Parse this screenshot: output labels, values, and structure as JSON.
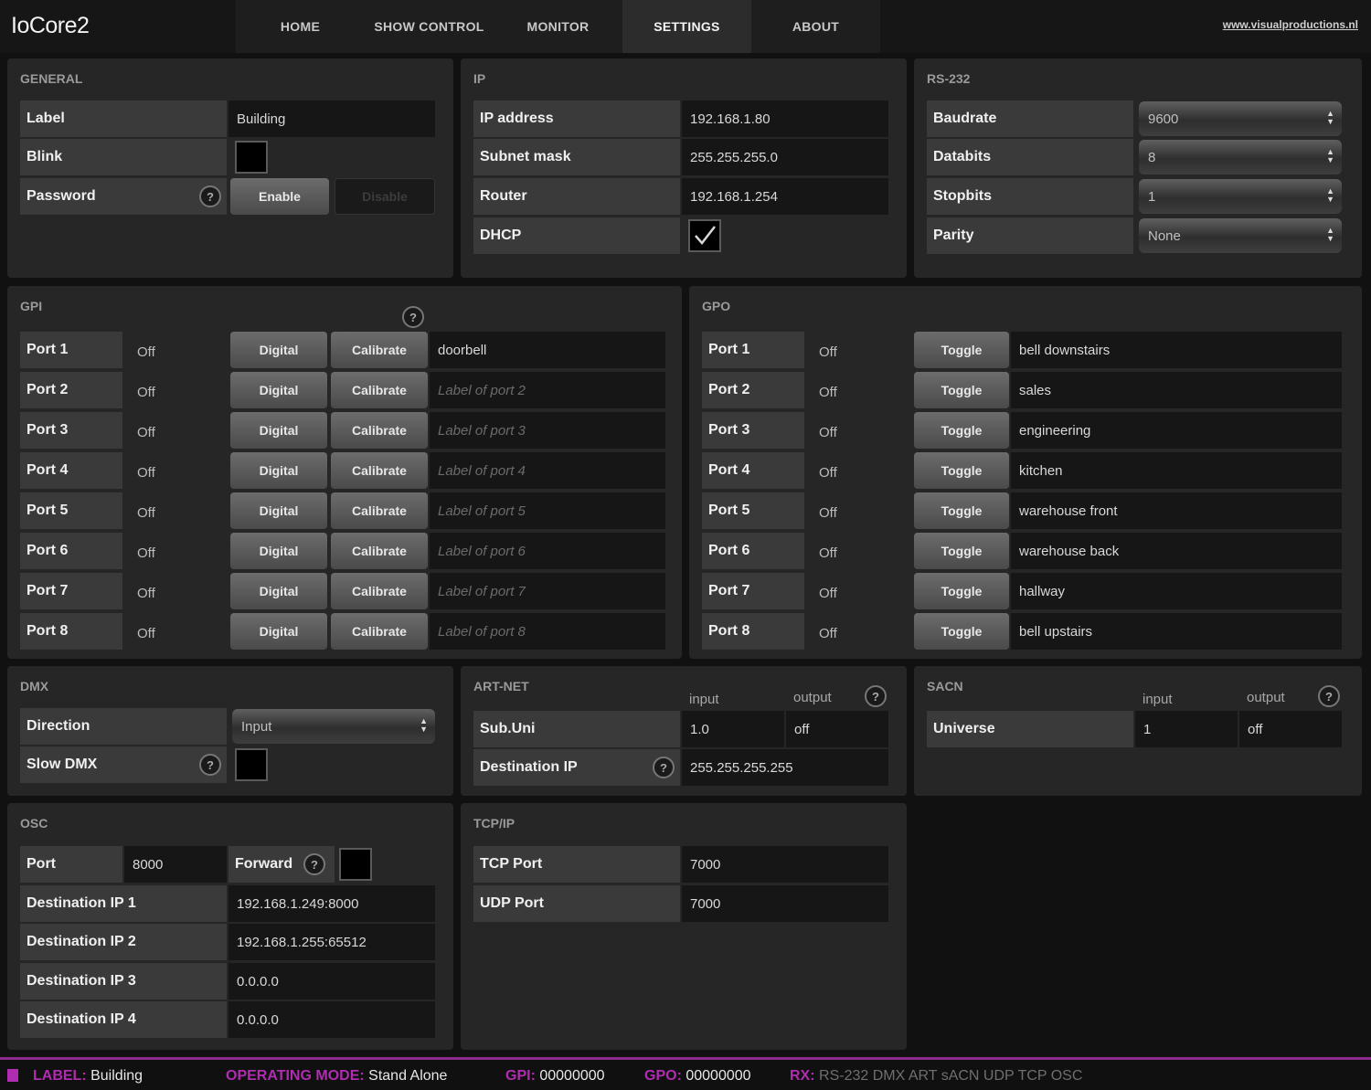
{
  "app": {
    "title": "IoCore2",
    "website": "www.visualproductions.nl",
    "accent_color": "#b02cb0",
    "nav": [
      "HOME",
      "SHOW CONTROL",
      "MONITOR",
      "SETTINGS",
      "ABOUT"
    ],
    "active_nav": "SETTINGS"
  },
  "general": {
    "title": "GENERAL",
    "label_label": "Label",
    "label_value": "Building",
    "blink_label": "Blink",
    "blink_checked": false,
    "password_label": "Password",
    "password_help_icon": "help-icon",
    "enable_label": "Enable",
    "disable_label": "Disable"
  },
  "ip": {
    "title": "IP",
    "address_label": "IP address",
    "address_value": "192.168.1.80",
    "subnet_label": "Subnet mask",
    "subnet_value": "255.255.255.0",
    "router_label": "Router",
    "router_value": "192.168.1.254",
    "dhcp_label": "DHCP",
    "dhcp_checked": true
  },
  "rs232": {
    "title": "RS-232",
    "baud_label": "Baudrate",
    "baud_value": "9600",
    "databits_label": "Databits",
    "databits_value": "8",
    "stopbits_label": "Stopbits",
    "stopbits_value": "1",
    "parity_label": "Parity",
    "parity_value": "None"
  },
  "gpi": {
    "title": "GPI",
    "digital_label": "Digital",
    "calibrate_label": "Calibrate",
    "ports": [
      {
        "name": "Port 1",
        "state": "Off",
        "label": "doorbell",
        "is_placeholder": false
      },
      {
        "name": "Port 2",
        "state": "Off",
        "label": "Label of port 2",
        "is_placeholder": true
      },
      {
        "name": "Port 3",
        "state": "Off",
        "label": "Label of port 3",
        "is_placeholder": true
      },
      {
        "name": "Port 4",
        "state": "Off",
        "label": "Label of port 4",
        "is_placeholder": true
      },
      {
        "name": "Port 5",
        "state": "Off",
        "label": "Label of port 5",
        "is_placeholder": true
      },
      {
        "name": "Port 6",
        "state": "Off",
        "label": "Label of port 6",
        "is_placeholder": true
      },
      {
        "name": "Port 7",
        "state": "Off",
        "label": "Label of port 7",
        "is_placeholder": true
      },
      {
        "name": "Port 8",
        "state": "Off",
        "label": "Label of port 8",
        "is_placeholder": true
      }
    ]
  },
  "gpo": {
    "title": "GPO",
    "toggle_label": "Toggle",
    "ports": [
      {
        "name": "Port 1",
        "state": "Off",
        "label": "bell downstairs"
      },
      {
        "name": "Port 2",
        "state": "Off",
        "label": "sales"
      },
      {
        "name": "Port 3",
        "state": "Off",
        "label": "engineering"
      },
      {
        "name": "Port 4",
        "state": "Off",
        "label": "kitchen"
      },
      {
        "name": "Port 5",
        "state": "Off",
        "label": "warehouse front"
      },
      {
        "name": "Port 6",
        "state": "Off",
        "label": "warehouse back"
      },
      {
        "name": "Port 7",
        "state": "Off",
        "label": "hallway"
      },
      {
        "name": "Port 8",
        "state": "Off",
        "label": "bell upstairs"
      }
    ]
  },
  "dmx": {
    "title": "DMX",
    "direction_label": "Direction",
    "direction_value": "Input",
    "slow_label": "Slow DMX",
    "slow_checked": false
  },
  "artnet": {
    "title": "ART-NET",
    "input_head": "input",
    "output_head": "output",
    "subuni_label": "Sub.Uni",
    "subuni_input": "1.0",
    "subuni_output": "off",
    "dest_label": "Destination IP",
    "dest_value": "255.255.255.255"
  },
  "sacn": {
    "title": "SACN",
    "input_head": "input",
    "output_head": "output",
    "universe_label": "Universe",
    "universe_input": "1",
    "universe_output": "off"
  },
  "osc": {
    "title": "OSC",
    "port_label": "Port",
    "port_value": "8000",
    "forward_label": "Forward",
    "forward_checked": false,
    "dest1_label": "Destination IP 1",
    "dest1_value": "192.168.1.249:8000",
    "dest2_label": "Destination IP 2",
    "dest2_value": "192.168.1.255:65512",
    "dest3_label": "Destination IP 3",
    "dest3_value": "0.0.0.0",
    "dest4_label": "Destination IP 4",
    "dest4_value": "0.0.0.0"
  },
  "tcpip": {
    "title": "TCP/IP",
    "tcp_label": "TCP Port",
    "tcp_value": "7000",
    "udp_label": "UDP Port",
    "udp_value": "7000"
  },
  "status": {
    "label_key": "LABEL:",
    "label_value": "Building",
    "mode_key": "OPERATING MODE:",
    "mode_value": "Stand Alone",
    "gpi_key": "GPI:",
    "gpi_value": "00000000",
    "gpo_key": "GPO:",
    "gpo_value": "00000000",
    "rx_key": "RX:",
    "rx_value": "RS-232 DMX ART sACN UDP TCP OSC"
  }
}
